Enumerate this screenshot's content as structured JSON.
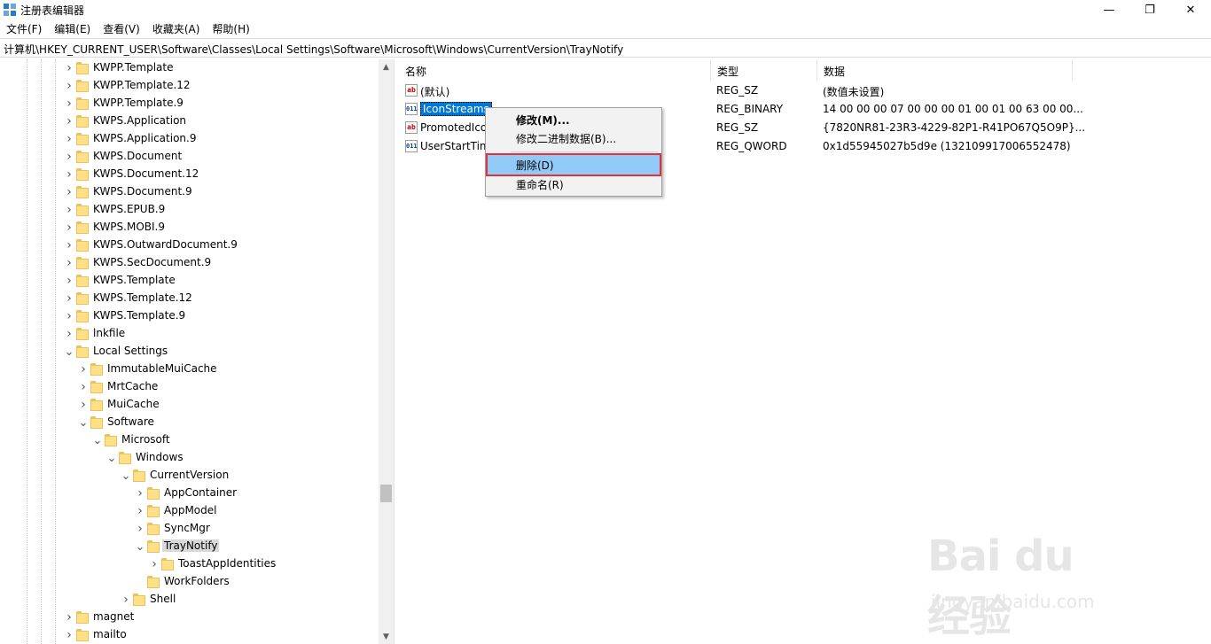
{
  "window": {
    "title": "注册表编辑器",
    "minimize_glyph": "—",
    "maximize_glyph": "❐",
    "close_glyph": "✕"
  },
  "menu": [
    "文件(F)",
    "编辑(E)",
    "查看(V)",
    "收藏夹(A)",
    "帮助(H)"
  ],
  "address": "计算机\\HKEY_CURRENT_USER\\Software\\Classes\\Local Settings\\Software\\Microsoft\\Windows\\CurrentVersion\\TrayNotify",
  "tree": [
    {
      "label": "KWPP.Template",
      "expanded": false
    },
    {
      "label": "KWPP.Template.12",
      "expanded": false
    },
    {
      "label": "KWPP.Template.9",
      "expanded": false
    },
    {
      "label": "KWPS.Application",
      "expanded": false
    },
    {
      "label": "KWPS.Application.9",
      "expanded": false
    },
    {
      "label": "KWPS.Document",
      "expanded": false
    },
    {
      "label": "KWPS.Document.12",
      "expanded": false
    },
    {
      "label": "KWPS.Document.9",
      "expanded": false
    },
    {
      "label": "KWPS.EPUB.9",
      "expanded": false
    },
    {
      "label": "KWPS.MOBI.9",
      "expanded": false
    },
    {
      "label": "KWPS.OutwardDocument.9",
      "expanded": false
    },
    {
      "label": "KWPS.SecDocument.9",
      "expanded": false
    },
    {
      "label": "KWPS.Template",
      "expanded": false
    },
    {
      "label": "KWPS.Template.12",
      "expanded": false
    },
    {
      "label": "KWPS.Template.9",
      "expanded": false
    },
    {
      "label": "lnkfile",
      "expanded": false
    },
    {
      "label": "Local Settings",
      "expanded": true
    },
    {
      "label": "ImmutableMuiCache",
      "expanded": false
    },
    {
      "label": "MrtCache",
      "expanded": false
    },
    {
      "label": "MuiCache",
      "expanded": false
    },
    {
      "label": "Software",
      "expanded": true
    },
    {
      "label": "Microsoft",
      "expanded": true
    },
    {
      "label": "Windows",
      "expanded": true
    },
    {
      "label": "CurrentVersion",
      "expanded": true
    },
    {
      "label": "AppContainer",
      "expanded": false
    },
    {
      "label": "AppModel",
      "expanded": false
    },
    {
      "label": "SyncMgr",
      "expanded": false
    },
    {
      "label": "TrayNotify",
      "expanded": true,
      "selected": true
    },
    {
      "label": "ToastAppIdentities",
      "expanded": false
    },
    {
      "label": "WorkFolders",
      "expanded": false
    },
    {
      "label": "Shell",
      "expanded": false
    },
    {
      "label": "magnet",
      "expanded": false
    },
    {
      "label": "mailto",
      "expanded": false
    }
  ],
  "columns": {
    "name": "名称",
    "type": "类型",
    "data": "数据"
  },
  "values": [
    {
      "name": "(默认)",
      "type": "REG_SZ",
      "data": "(数值未设置)",
      "icon": "string-value-icon"
    },
    {
      "name": "IconStreams",
      "type": "REG_BINARY",
      "data": "14 00 00 00 07 00 00 00 01 00 01 00 63 00 00...",
      "icon": "binary-value-icon",
      "selected": true
    },
    {
      "name": "PromotedIco",
      "type": "REG_SZ",
      "data": "{7820NR81-23R3-4229-82P1-R41PO67Q5O9P}...",
      "icon": "string-value-icon"
    },
    {
      "name": "UserStartTim",
      "type": "REG_QWORD",
      "data": "0x1d55945027b5d9e (132109917006552478)",
      "icon": "binary-value-icon"
    }
  ],
  "value_icon_text": {
    "string": "ab",
    "binary": "011\n110"
  },
  "context_menu": {
    "modify": "修改(M)...",
    "modify_binary": "修改二进制数据(B)...",
    "delete": "删除(D)",
    "rename": "重命名(R)"
  },
  "tree_scroll": {
    "up": "▲",
    "down": "▼"
  },
  "watermark": {
    "brand": "Bai du 经验",
    "url": "jingyan.baidu.com"
  },
  "colors": {
    "selection": "#0078d7",
    "menu_highlight": "#91c9f7",
    "annotation_box": "#e0323a",
    "folder": "#ffe08a"
  }
}
